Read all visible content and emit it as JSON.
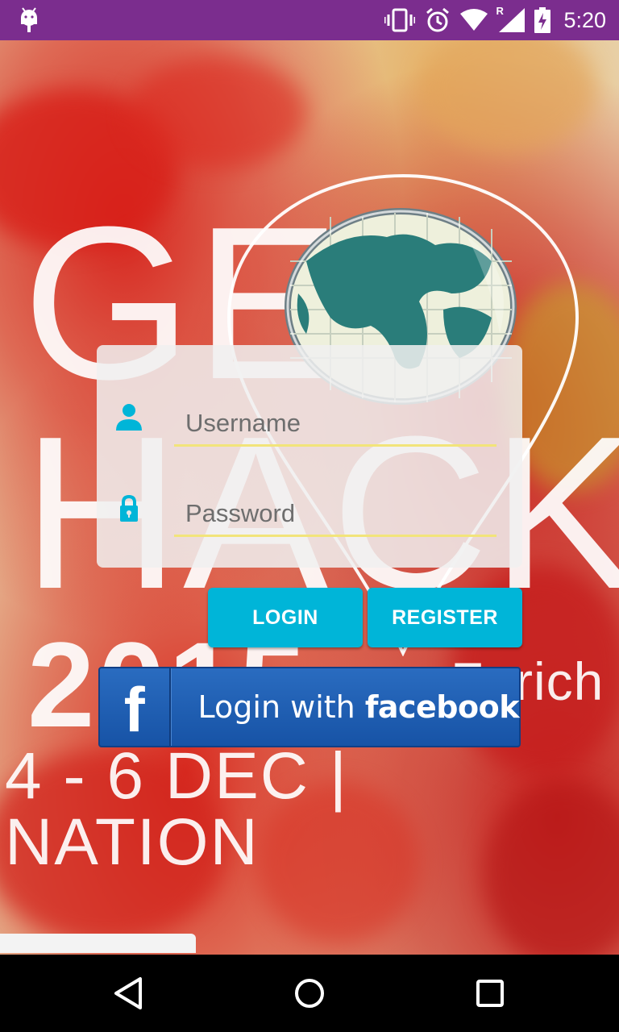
{
  "status_bar": {
    "time": "5:20",
    "icons": [
      "android-debug-icon",
      "vibrate-icon",
      "alarm-icon",
      "wifi-icon",
      "signal-icon",
      "battery-charging-icon"
    ],
    "roaming_label": "R"
  },
  "background": {
    "event_logo_letters_top": "GE",
    "event_logo_letters_mid": "HACKA",
    "event_year": "2015",
    "event_city": "Zurich",
    "event_dates": "4 - 6 DEC | NATION"
  },
  "login_form": {
    "username_placeholder": "Username",
    "password_placeholder": "Password"
  },
  "buttons": {
    "login_label": "LOGIN",
    "register_label": "REGISTER",
    "facebook_prefix": "Login with ",
    "facebook_brand": "facebook",
    "facebook_logo_letter": "f"
  },
  "colors": {
    "status_bar": "#7b2d8e",
    "accent": "#00b5d8",
    "underline": "#f2e47a",
    "facebook_blue": "#1d5bb0"
  },
  "nav_bar": {
    "icons": [
      "back-icon",
      "home-icon",
      "recents-icon"
    ]
  }
}
